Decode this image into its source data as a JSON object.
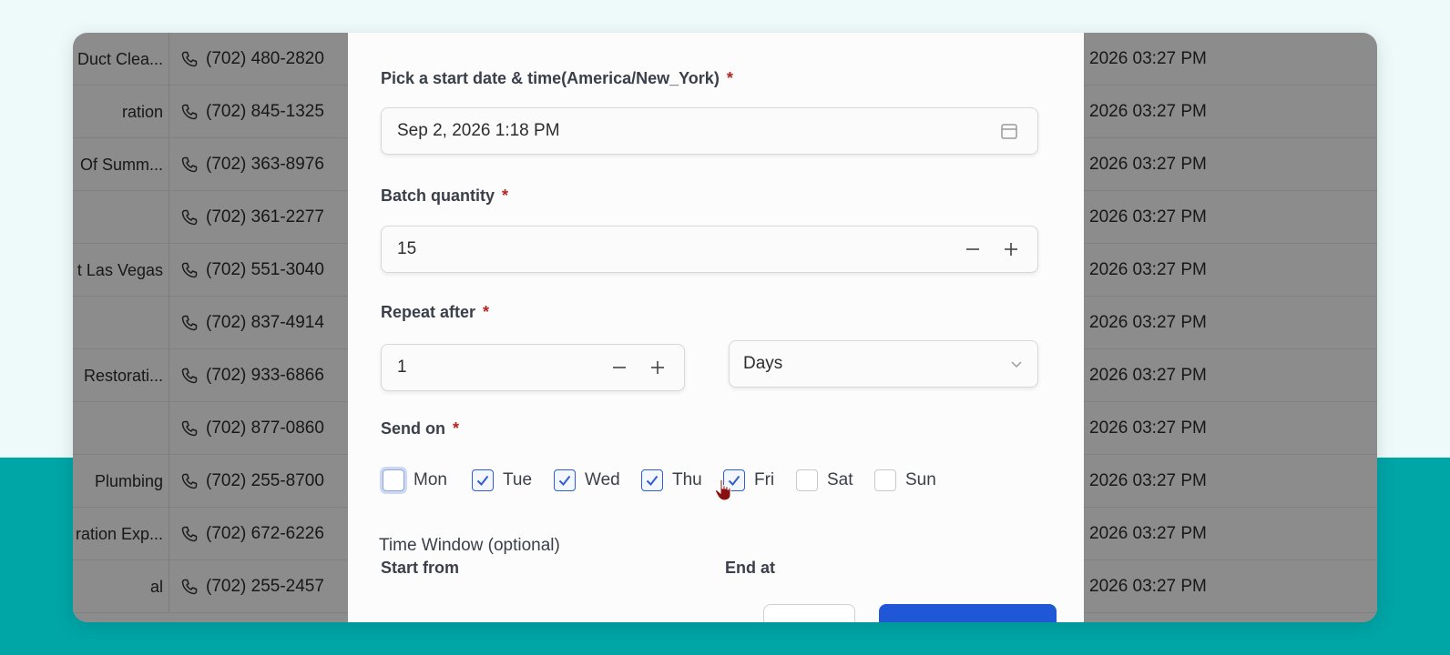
{
  "table": {
    "rows": [
      {
        "name": "Duct Clea...",
        "phone": "(702) 480-2820",
        "date": "2026 03:27 PM"
      },
      {
        "name": "ration",
        "phone": "(702) 845-1325",
        "date": "2026 03:27 PM"
      },
      {
        "name": "Of Summ...",
        "phone": "(702) 363-8976",
        "date": "2026 03:27 PM"
      },
      {
        "name": "",
        "phone": "(702) 361-2277",
        "date": "2026 03:27 PM"
      },
      {
        "name": "t Las Vegas",
        "phone": "(702) 551-3040",
        "date": "2026 03:27 PM"
      },
      {
        "name": "",
        "phone": "(702) 837-4914",
        "date": "2026 03:27 PM"
      },
      {
        "name": "Restorati...",
        "phone": "(702) 933-6866",
        "date": "2026 03:27 PM"
      },
      {
        "name": "",
        "phone": "(702) 877-0860",
        "date": "2026 03:27 PM"
      },
      {
        "name": "Plumbing",
        "phone": "(702) 255-8700",
        "date": "2026 03:27 PM"
      },
      {
        "name": "ration Exp...",
        "phone": "(702) 672-6226",
        "date": "2026 03:27 PM"
      },
      {
        "name": "al",
        "phone": "(702) 255-2457",
        "date": "2026 03:27 PM"
      }
    ]
  },
  "modal": {
    "start_label": "Pick a start date & time(America/New_York)",
    "required_mark": "*",
    "start_value": "Sep 2, 2026 1:18 PM",
    "batch_label": "Batch quantity",
    "batch_value": "15",
    "repeat_label": "Repeat after",
    "repeat_value": "1",
    "repeat_unit": "Days",
    "send_on_label": "Send on",
    "days": [
      {
        "label": "Mon",
        "checked": false
      },
      {
        "label": "Tue",
        "checked": true
      },
      {
        "label": "Wed",
        "checked": true
      },
      {
        "label": "Thu",
        "checked": true
      },
      {
        "label": "Fri",
        "checked": true
      },
      {
        "label": "Sat",
        "checked": false
      },
      {
        "label": "Sun",
        "checked": false
      }
    ],
    "time_window_title": "Time Window (optional)",
    "start_from_label": "Start from",
    "end_at_label": "End at"
  },
  "colors": {
    "accent": "#2f5ed0",
    "primary_button": "#1f57d6",
    "required": "#b3261e",
    "teal_background": "#00a5a6"
  },
  "icons": {
    "phone": "phone-icon",
    "calendar": "calendar-icon",
    "minus": "minus-icon",
    "plus": "plus-icon",
    "chevron": "chevron-down-icon",
    "check": "check-icon",
    "cursor": "hand-cursor-icon"
  }
}
